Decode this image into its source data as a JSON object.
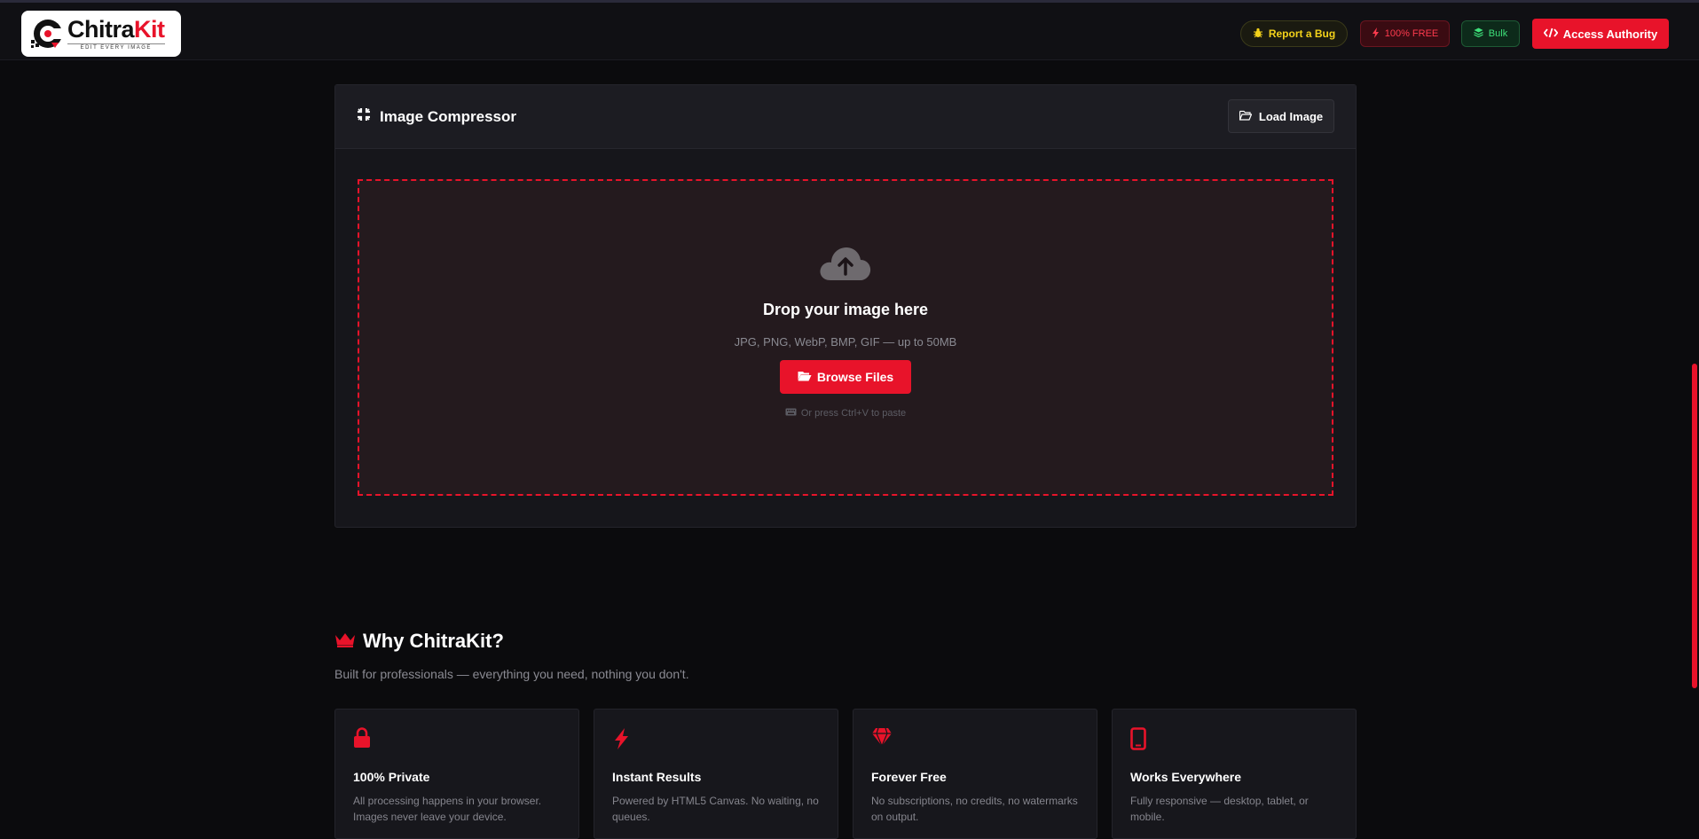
{
  "header": {
    "logo_title_a": "Chitra",
    "logo_title_b": "Kit",
    "logo_tagline": "EDIT EVERY IMAGE",
    "report_bug": "Report a Bug",
    "free_badge": "100% FREE",
    "bulk": "Bulk",
    "access_authority": "Access Authority"
  },
  "compressor": {
    "title": "Image Compressor",
    "load_image": "Load Image",
    "drop_title": "Drop your image here",
    "drop_formats": "JPG, PNG, WebP, BMP, GIF — up to 50MB",
    "browse_files": "Browse Files",
    "paste_hint": "Or press Ctrl+V to paste"
  },
  "why": {
    "title": "Why ChitraKit?",
    "subtitle": "Built for professionals — everything you need, nothing you don't.",
    "cards": [
      {
        "icon": "lock-icon",
        "title": "100% Private",
        "text": "All processing happens in your browser. Images never leave your device."
      },
      {
        "icon": "bolt-icon",
        "title": "Instant Results",
        "text": "Powered by HTML5 Canvas. No waiting, no queues."
      },
      {
        "icon": "gem-icon",
        "title": "Forever Free",
        "text": "No subscriptions, no credits, no watermarks on output."
      },
      {
        "icon": "mobile-icon",
        "title": "Works Everywhere",
        "text": "Fully responsive — desktop, tablet, or mobile."
      }
    ]
  },
  "colors": {
    "accent": "#e8132a",
    "background": "#0b0b0d",
    "panel": "#16161b",
    "bug_yellow": "#f3d21a",
    "bulk_green": "#3ee07a"
  }
}
